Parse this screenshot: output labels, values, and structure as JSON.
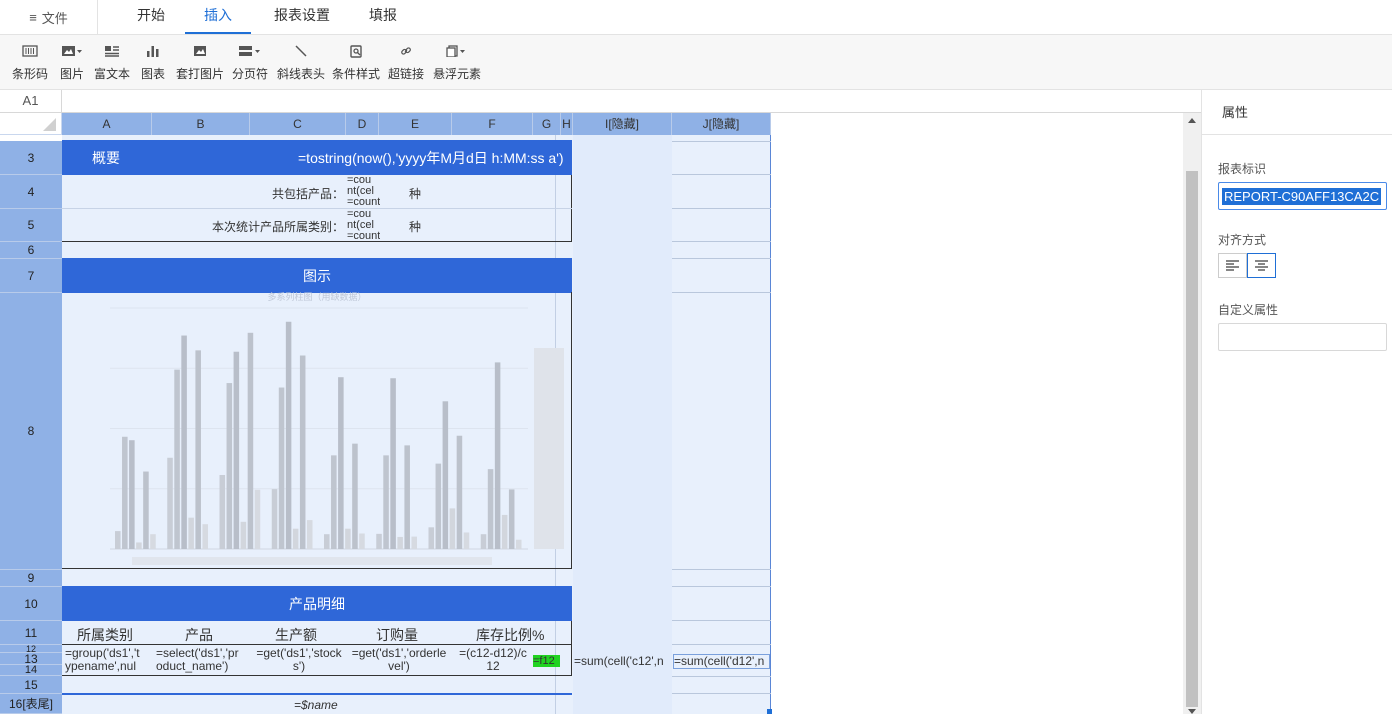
{
  "menu": {
    "file_label": "文件",
    "tabs": [
      {
        "label": "开始",
        "active": false
      },
      {
        "label": "插入",
        "active": true
      },
      {
        "label": "报表设置",
        "active": false
      },
      {
        "label": "填报",
        "active": false
      }
    ]
  },
  "toolbar": {
    "items": [
      {
        "label": "条形码",
        "icon": "barcode-icon"
      },
      {
        "label": "图片",
        "icon": "image-icon"
      },
      {
        "label": "富文本",
        "icon": "rich-text-icon"
      },
      {
        "label": "图表",
        "icon": "chart-icon"
      },
      {
        "label": "套打图片",
        "icon": "print-image-icon"
      },
      {
        "label": "分页符",
        "icon": "page-break-icon"
      },
      {
        "label": "斜线表头",
        "icon": "diagonal-header-icon"
      },
      {
        "label": "条件样式",
        "icon": "condition-style-icon"
      },
      {
        "label": "超链接",
        "icon": "link-icon"
      },
      {
        "label": "悬浮元素",
        "icon": "float-element-icon"
      }
    ]
  },
  "formula": {
    "cell_ref": "A1"
  },
  "columns": [
    "A",
    "B",
    "C",
    "D",
    "E",
    "F",
    "G",
    "H",
    "I[隐藏]",
    "J[隐藏]"
  ],
  "rows": [
    "3",
    "4",
    "5",
    "6",
    "7",
    "8",
    "9",
    "10",
    "11",
    "12",
    "13",
    "14",
    "15",
    "16[表尾]"
  ],
  "cells": {
    "overview_title": "概要",
    "overview_formula": "=tostring(now(),'yyyy年M月d日 h:MM:ss a')",
    "total_products_label": "共包括产品：",
    "count_formula_1": "=count(cel",
    "count_formula_1b": "nt(cel",
    "unit_1": "种",
    "category_label": "本次统计产品所属类别：",
    "count_formula_2": "=cou",
    "count_formula_2b": "nt(cel",
    "unit_2": "种",
    "chart_band": "图示",
    "detail_band": "产品明细",
    "hdr_category": "所属类别",
    "hdr_product": "产品",
    "hdr_output": "生产额",
    "hdr_order": "订购量",
    "hdr_stock": "库存比例%",
    "f_group_1": "=group('ds1','t",
    "f_group_2": "ypename',nul",
    "f_select_1": "=select('ds1','pr",
    "f_select_2": "oduct_name')",
    "f_get_1": "=get('ds1','stock",
    "f_get_2": "s')",
    "f_order_1": "=get('ds1','orderle",
    "f_order_2": "vel')",
    "f_ratio_1": "=(c12-d12)/c",
    "f_ratio_2": "12",
    "f_flag": "=f12",
    "f_sum_i": "=sum(cell('c12',n",
    "f_sum_j": "=sum(cell('d12',n",
    "footer_name": "=$name",
    "count_formula_1c": "=cou"
  },
  "chart_data": {
    "type": "bar",
    "title": "多系列柱图（用缺数据）",
    "categories": [
      "",
      "",
      "",
      "",
      "",
      "",
      "",
      ""
    ],
    "series": [
      {
        "values": [
          520,
          2650,
          2150,
          1740,
          430,
          440,
          630,
          430
        ]
      },
      {
        "values": [
          3260,
          5210,
          4820,
          4690,
          2720,
          2720,
          2480,
          2320
        ]
      },
      {
        "values": [
          3160,
          6200,
          5730,
          6600,
          4990,
          4960,
          4290,
          5420
        ]
      },
      {
        "values": [
          190,
          910,
          790,
          590,
          590,
          350,
          1180,
          990
        ]
      },
      {
        "values": [
          2250,
          5770,
          6280,
          5620,
          3060,
          3010,
          3290,
          1730
        ]
      },
      {
        "values": [
          430,
          720,
          1720,
          840,
          450,
          360,
          480,
          270
        ]
      }
    ],
    "ylim": [
      0,
      7000
    ]
  },
  "panel": {
    "title": "属性",
    "report_id_label": "报表标识",
    "report_id_value": "REPORT-C90AFF13CA2C",
    "align_label": "对齐方式",
    "custom_attr_label": "自定义属性"
  }
}
